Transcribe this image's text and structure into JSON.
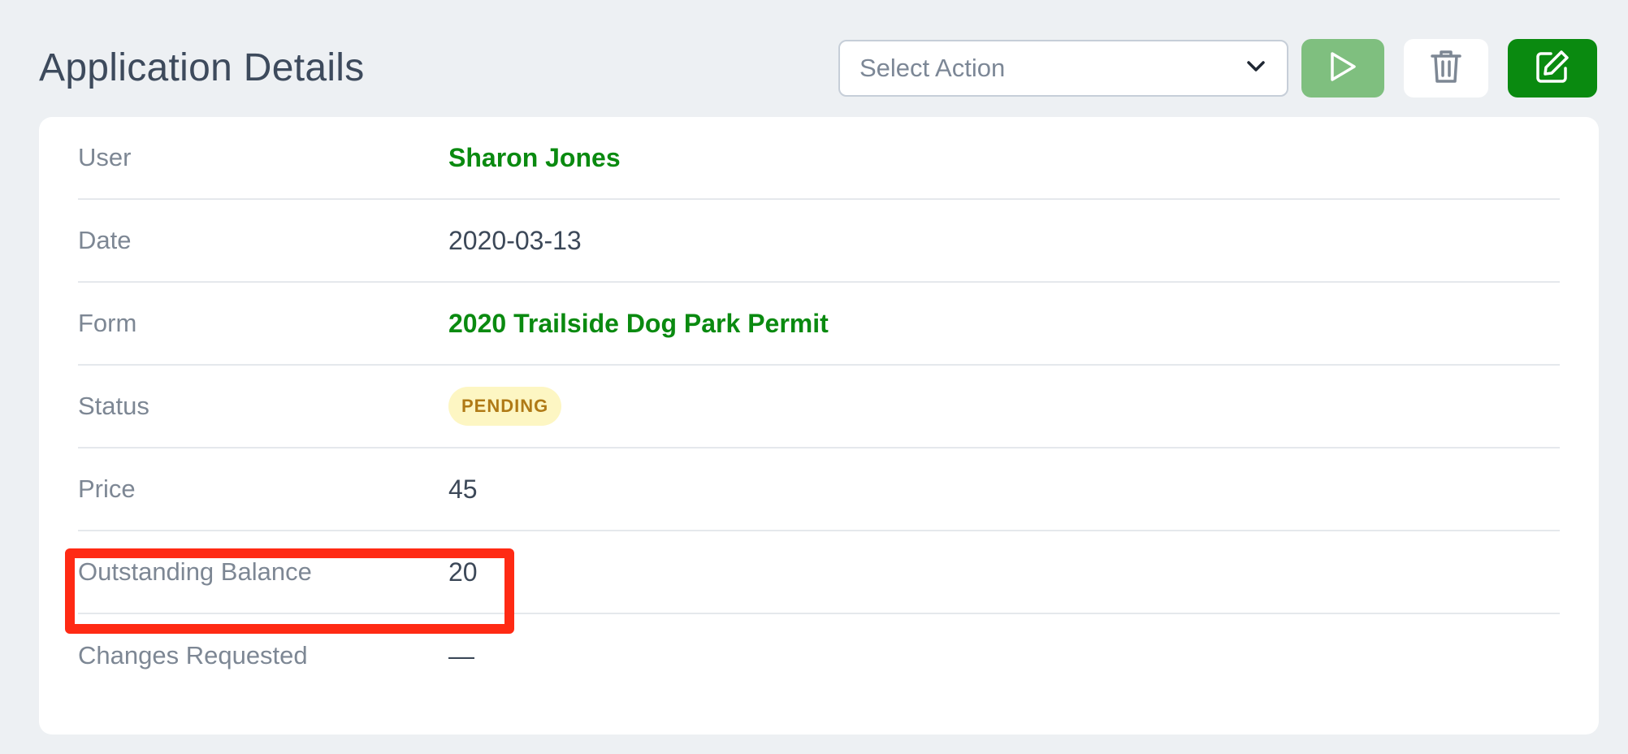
{
  "header": {
    "title": "Application Details"
  },
  "toolbar": {
    "select": {
      "placeholder": "Select Action"
    },
    "run_icon": "play-icon",
    "delete_icon": "trash-icon",
    "edit_icon": "edit-icon"
  },
  "details": {
    "rows": [
      {
        "label": "User",
        "value": "Sharon Jones"
      },
      {
        "label": "Date",
        "value": "2020-03-13"
      },
      {
        "label": "Form",
        "value": "2020 Trailside Dog Park Permit"
      },
      {
        "label": "Status",
        "value": "PENDING"
      },
      {
        "label": "Price",
        "value": "45"
      },
      {
        "label": "Outstanding Balance",
        "value": "20"
      },
      {
        "label": "Changes Requested",
        "value": "—"
      }
    ]
  },
  "colors": {
    "background": "#edf0f3",
    "accent_green": "#0a8a10",
    "run_button_green": "#7fbf7f",
    "status_badge_bg": "#fdf6c3",
    "status_badge_text": "#b07a16",
    "highlight_red": "#ff2a14"
  }
}
